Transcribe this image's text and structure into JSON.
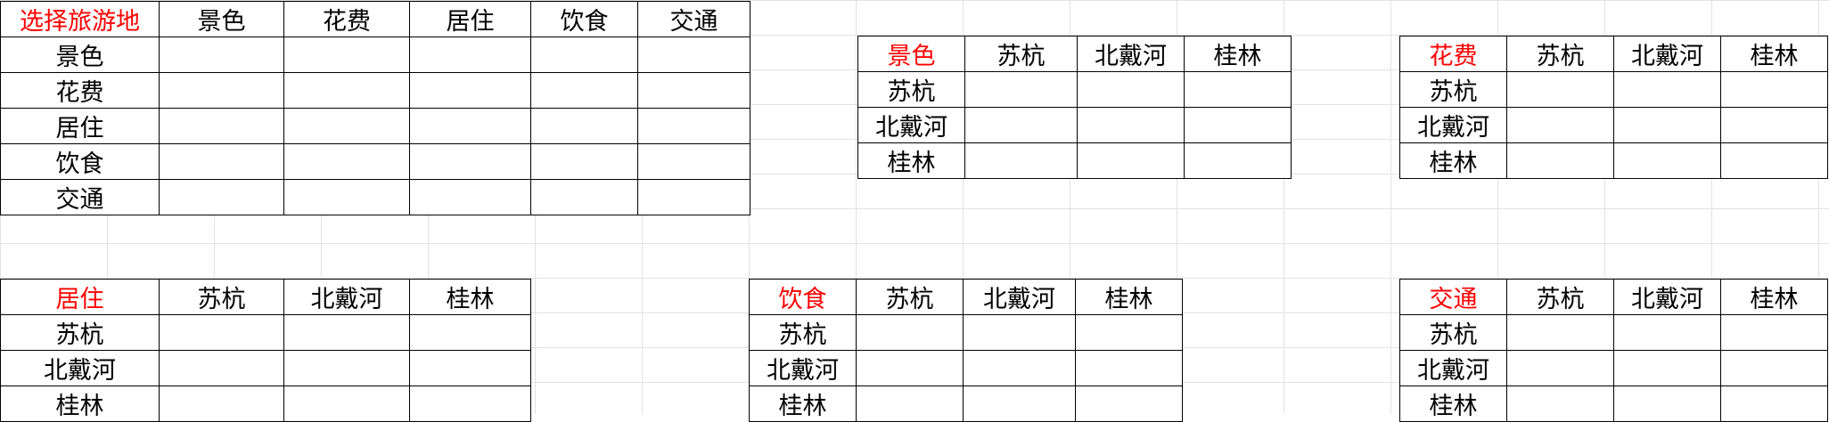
{
  "colors": {
    "accent_text": "#ff0000",
    "grid": "#e2e2e2",
    "border": "#000000"
  },
  "tables": [
    {
      "corner": "选择旅游地",
      "columns": [
        "景色",
        "花费",
        "居住",
        "饮食",
        "交通"
      ],
      "rows": [
        "景色",
        "花费",
        "居住",
        "饮食",
        "交通"
      ]
    },
    {
      "corner": "景色",
      "columns": [
        "苏杭",
        "北戴河",
        "桂林"
      ],
      "rows": [
        "苏杭",
        "北戴河",
        "桂林"
      ]
    },
    {
      "corner": "花费",
      "columns": [
        "苏杭",
        "北戴河",
        "桂林"
      ],
      "rows": [
        "苏杭",
        "北戴河",
        "桂林"
      ]
    },
    {
      "corner": "居住",
      "columns": [
        "苏杭",
        "北戴河",
        "桂林"
      ],
      "rows": [
        "苏杭",
        "北戴河",
        "桂林"
      ]
    },
    {
      "corner": "饮食",
      "columns": [
        "苏杭",
        "北戴河",
        "桂林"
      ],
      "rows": [
        "苏杭",
        "北戴河",
        "桂林"
      ]
    },
    {
      "corner": "交通",
      "columns": [
        "苏杭",
        "北戴河",
        "桂林"
      ],
      "rows": [
        "苏杭",
        "北戴河",
        "桂林"
      ]
    }
  ]
}
